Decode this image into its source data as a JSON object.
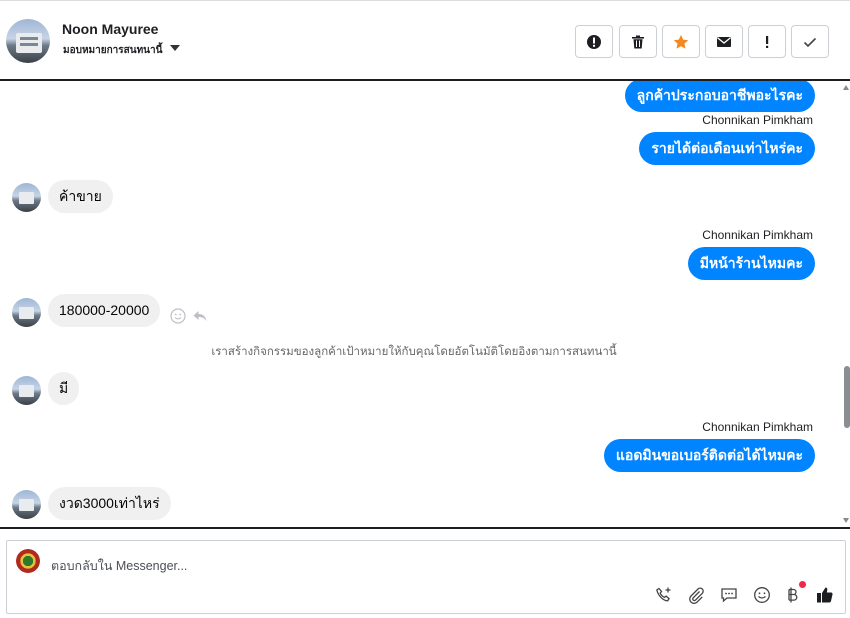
{
  "header": {
    "contact_name": "Noon Mayuree",
    "assign_label": "มอบหมายการสนทนานี้",
    "buttons": [
      "spam-icon",
      "trash-icon",
      "star-icon",
      "mail-icon",
      "alert-icon",
      "check-icon"
    ],
    "star_color": "#f5891f"
  },
  "messages": {
    "out_1": "ลูกค้าประกอบอาชีพอะไรคะ",
    "sender_1": "Chonnikan Pimkham",
    "out_2": "รายได้ต่อเดือนเท่าไหร่คะ",
    "in_1": "ค้าขาย",
    "sender_2": "Chonnikan Pimkham",
    "out_3": "มีหน้าร้านไหมคะ",
    "in_2": "180000-20000",
    "system_note": "เราสร้างกิจกรรมของลูกค้าเป้าหมายให้กับคุณโดยอัตโนมัติโดยอิงตามการสนทนานี้",
    "in_3": "มี",
    "sender_3": "Chonnikan Pimkham",
    "out_4": "แอดมินขอเบอร์ติดต่อได้ไหมคะ",
    "in_4": "งวด3000เท่าไหร่"
  },
  "composer": {
    "placeholder": "ตอบกลับใน Messenger...",
    "tools": [
      "call-add-icon",
      "attach-icon",
      "saved-reply-icon",
      "emoji-icon",
      "baht-payment-icon",
      "like-icon"
    ]
  },
  "colors": {
    "outgoing_bubble": "#0084ff",
    "incoming_bubble": "#f0f0f0",
    "notification_dot": "#f02849"
  }
}
